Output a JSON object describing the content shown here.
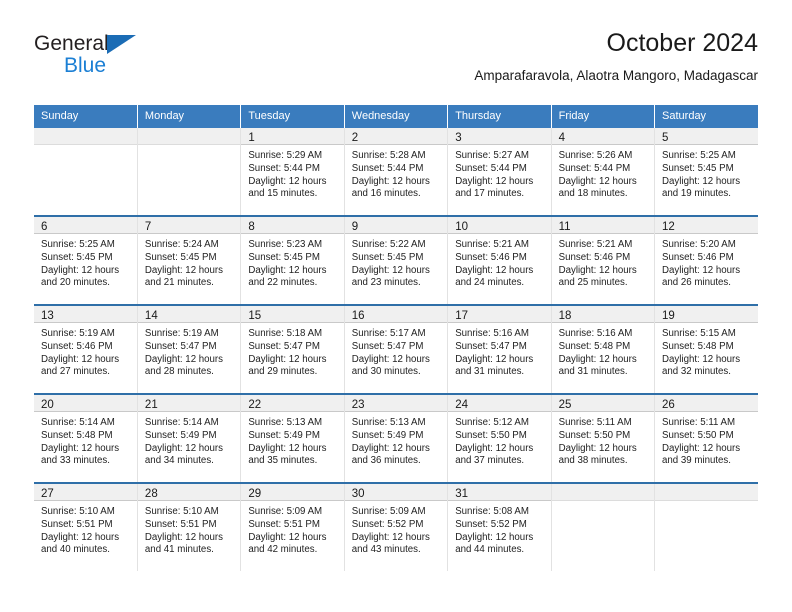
{
  "brand": {
    "name_top": "General",
    "name_bottom": "Blue",
    "triangle_color": "#1b6cb5",
    "blue_color": "#1b7fd4"
  },
  "header": {
    "title": "October 2024",
    "subtitle": "Amparafaravola, Alaotra Mangoro, Madagascar"
  },
  "theme": {
    "header_bg": "#3a7cbe",
    "header_text": "#ffffff",
    "daynum_band_bg": "#f0f0f0",
    "week_separator": "#2f6fa8"
  },
  "weekday_headers": [
    "Sunday",
    "Monday",
    "Tuesday",
    "Wednesday",
    "Thursday",
    "Friday",
    "Saturday"
  ],
  "labels": {
    "sunrise_prefix": "Sunrise:",
    "sunset_prefix": "Sunset:",
    "daylight_prefix": "Daylight:"
  },
  "weeks": [
    [
      {
        "day": "",
        "sunrise": "",
        "sunset": "",
        "daylight1": "",
        "daylight2": ""
      },
      {
        "day": "",
        "sunrise": "",
        "sunset": "",
        "daylight1": "",
        "daylight2": ""
      },
      {
        "day": "1",
        "sunrise": "Sunrise: 5:29 AM",
        "sunset": "Sunset: 5:44 PM",
        "daylight1": "Daylight: 12 hours",
        "daylight2": "and 15 minutes."
      },
      {
        "day": "2",
        "sunrise": "Sunrise: 5:28 AM",
        "sunset": "Sunset: 5:44 PM",
        "daylight1": "Daylight: 12 hours",
        "daylight2": "and 16 minutes."
      },
      {
        "day": "3",
        "sunrise": "Sunrise: 5:27 AM",
        "sunset": "Sunset: 5:44 PM",
        "daylight1": "Daylight: 12 hours",
        "daylight2": "and 17 minutes."
      },
      {
        "day": "4",
        "sunrise": "Sunrise: 5:26 AM",
        "sunset": "Sunset: 5:44 PM",
        "daylight1": "Daylight: 12 hours",
        "daylight2": "and 18 minutes."
      },
      {
        "day": "5",
        "sunrise": "Sunrise: 5:25 AM",
        "sunset": "Sunset: 5:45 PM",
        "daylight1": "Daylight: 12 hours",
        "daylight2": "and 19 minutes."
      }
    ],
    [
      {
        "day": "6",
        "sunrise": "Sunrise: 5:25 AM",
        "sunset": "Sunset: 5:45 PM",
        "daylight1": "Daylight: 12 hours",
        "daylight2": "and 20 minutes."
      },
      {
        "day": "7",
        "sunrise": "Sunrise: 5:24 AM",
        "sunset": "Sunset: 5:45 PM",
        "daylight1": "Daylight: 12 hours",
        "daylight2": "and 21 minutes."
      },
      {
        "day": "8",
        "sunrise": "Sunrise: 5:23 AM",
        "sunset": "Sunset: 5:45 PM",
        "daylight1": "Daylight: 12 hours",
        "daylight2": "and 22 minutes."
      },
      {
        "day": "9",
        "sunrise": "Sunrise: 5:22 AM",
        "sunset": "Sunset: 5:45 PM",
        "daylight1": "Daylight: 12 hours",
        "daylight2": "and 23 minutes."
      },
      {
        "day": "10",
        "sunrise": "Sunrise: 5:21 AM",
        "sunset": "Sunset: 5:46 PM",
        "daylight1": "Daylight: 12 hours",
        "daylight2": "and 24 minutes."
      },
      {
        "day": "11",
        "sunrise": "Sunrise: 5:21 AM",
        "sunset": "Sunset: 5:46 PM",
        "daylight1": "Daylight: 12 hours",
        "daylight2": "and 25 minutes."
      },
      {
        "day": "12",
        "sunrise": "Sunrise: 5:20 AM",
        "sunset": "Sunset: 5:46 PM",
        "daylight1": "Daylight: 12 hours",
        "daylight2": "and 26 minutes."
      }
    ],
    [
      {
        "day": "13",
        "sunrise": "Sunrise: 5:19 AM",
        "sunset": "Sunset: 5:46 PM",
        "daylight1": "Daylight: 12 hours",
        "daylight2": "and 27 minutes."
      },
      {
        "day": "14",
        "sunrise": "Sunrise: 5:19 AM",
        "sunset": "Sunset: 5:47 PM",
        "daylight1": "Daylight: 12 hours",
        "daylight2": "and 28 minutes."
      },
      {
        "day": "15",
        "sunrise": "Sunrise: 5:18 AM",
        "sunset": "Sunset: 5:47 PM",
        "daylight1": "Daylight: 12 hours",
        "daylight2": "and 29 minutes."
      },
      {
        "day": "16",
        "sunrise": "Sunrise: 5:17 AM",
        "sunset": "Sunset: 5:47 PM",
        "daylight1": "Daylight: 12 hours",
        "daylight2": "and 30 minutes."
      },
      {
        "day": "17",
        "sunrise": "Sunrise: 5:16 AM",
        "sunset": "Sunset: 5:47 PM",
        "daylight1": "Daylight: 12 hours",
        "daylight2": "and 31 minutes."
      },
      {
        "day": "18",
        "sunrise": "Sunrise: 5:16 AM",
        "sunset": "Sunset: 5:48 PM",
        "daylight1": "Daylight: 12 hours",
        "daylight2": "and 31 minutes."
      },
      {
        "day": "19",
        "sunrise": "Sunrise: 5:15 AM",
        "sunset": "Sunset: 5:48 PM",
        "daylight1": "Daylight: 12 hours",
        "daylight2": "and 32 minutes."
      }
    ],
    [
      {
        "day": "20",
        "sunrise": "Sunrise: 5:14 AM",
        "sunset": "Sunset: 5:48 PM",
        "daylight1": "Daylight: 12 hours",
        "daylight2": "and 33 minutes."
      },
      {
        "day": "21",
        "sunrise": "Sunrise: 5:14 AM",
        "sunset": "Sunset: 5:49 PM",
        "daylight1": "Daylight: 12 hours",
        "daylight2": "and 34 minutes."
      },
      {
        "day": "22",
        "sunrise": "Sunrise: 5:13 AM",
        "sunset": "Sunset: 5:49 PM",
        "daylight1": "Daylight: 12 hours",
        "daylight2": "and 35 minutes."
      },
      {
        "day": "23",
        "sunrise": "Sunrise: 5:13 AM",
        "sunset": "Sunset: 5:49 PM",
        "daylight1": "Daylight: 12 hours",
        "daylight2": "and 36 minutes."
      },
      {
        "day": "24",
        "sunrise": "Sunrise: 5:12 AM",
        "sunset": "Sunset: 5:50 PM",
        "daylight1": "Daylight: 12 hours",
        "daylight2": "and 37 minutes."
      },
      {
        "day": "25",
        "sunrise": "Sunrise: 5:11 AM",
        "sunset": "Sunset: 5:50 PM",
        "daylight1": "Daylight: 12 hours",
        "daylight2": "and 38 minutes."
      },
      {
        "day": "26",
        "sunrise": "Sunrise: 5:11 AM",
        "sunset": "Sunset: 5:50 PM",
        "daylight1": "Daylight: 12 hours",
        "daylight2": "and 39 minutes."
      }
    ],
    [
      {
        "day": "27",
        "sunrise": "Sunrise: 5:10 AM",
        "sunset": "Sunset: 5:51 PM",
        "daylight1": "Daylight: 12 hours",
        "daylight2": "and 40 minutes."
      },
      {
        "day": "28",
        "sunrise": "Sunrise: 5:10 AM",
        "sunset": "Sunset: 5:51 PM",
        "daylight1": "Daylight: 12 hours",
        "daylight2": "and 41 minutes."
      },
      {
        "day": "29",
        "sunrise": "Sunrise: 5:09 AM",
        "sunset": "Sunset: 5:51 PM",
        "daylight1": "Daylight: 12 hours",
        "daylight2": "and 42 minutes."
      },
      {
        "day": "30",
        "sunrise": "Sunrise: 5:09 AM",
        "sunset": "Sunset: 5:52 PM",
        "daylight1": "Daylight: 12 hours",
        "daylight2": "and 43 minutes."
      },
      {
        "day": "31",
        "sunrise": "Sunrise: 5:08 AM",
        "sunset": "Sunset: 5:52 PM",
        "daylight1": "Daylight: 12 hours",
        "daylight2": "and 44 minutes."
      },
      {
        "day": "",
        "sunrise": "",
        "sunset": "",
        "daylight1": "",
        "daylight2": ""
      },
      {
        "day": "",
        "sunrise": "",
        "sunset": "",
        "daylight1": "",
        "daylight2": ""
      }
    ]
  ]
}
